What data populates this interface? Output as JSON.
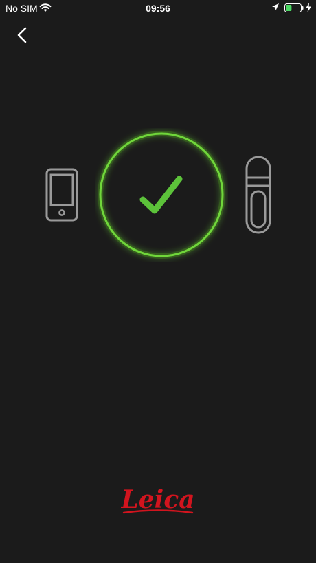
{
  "status_bar": {
    "carrier": "No SIM",
    "time": "09:56",
    "icons": [
      "wifi-icon",
      "location-arrow-icon",
      "battery-icon",
      "charging-bolt-icon"
    ],
    "battery_level": 0.4
  },
  "navigation": {
    "back_icon": "chevron-left-icon"
  },
  "pairing": {
    "left_device_icon": "smartphone-icon",
    "right_device_icon": "laser-meter-icon",
    "status_icon": "checkmark-icon",
    "status": "connected"
  },
  "brand": {
    "logo_text": "Leica",
    "logo_color": "#d2141e"
  },
  "colors": {
    "background": "#1b1b1b",
    "accent_green": "#6fd63a",
    "icon_gray": "#9a9a9a"
  }
}
